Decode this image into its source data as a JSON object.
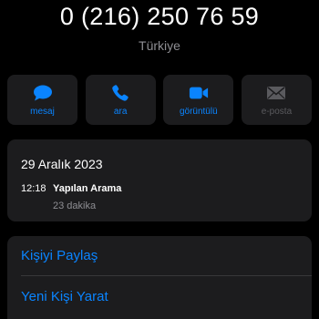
{
  "contact": {
    "phone_number": "0 (216) 250 76 59",
    "country": "Türkiye"
  },
  "actions": [
    {
      "label": "mesaj",
      "icon": "message-bubble-icon",
      "enabled": true
    },
    {
      "label": "ara",
      "icon": "phone-icon",
      "enabled": true
    },
    {
      "label": "görüntülü",
      "icon": "video-camera-icon",
      "enabled": true
    },
    {
      "label": "e-posta",
      "icon": "envelope-icon",
      "enabled": false
    }
  ],
  "call_history": {
    "date": "29 Aralık 2023",
    "entries": [
      {
        "time": "12:18",
        "type": "Yapılan Arama",
        "duration": "23 dakika"
      }
    ]
  },
  "menu": {
    "share_contact": "Kişiyi Paylaş",
    "create_new_contact": "Yeni Kişi Yarat"
  },
  "colors": {
    "background": "#000000",
    "card": "#1c1c1e",
    "accent": "#0a84ff",
    "secondary_text": "#8e8e93",
    "disabled": "#5a5a5e"
  }
}
